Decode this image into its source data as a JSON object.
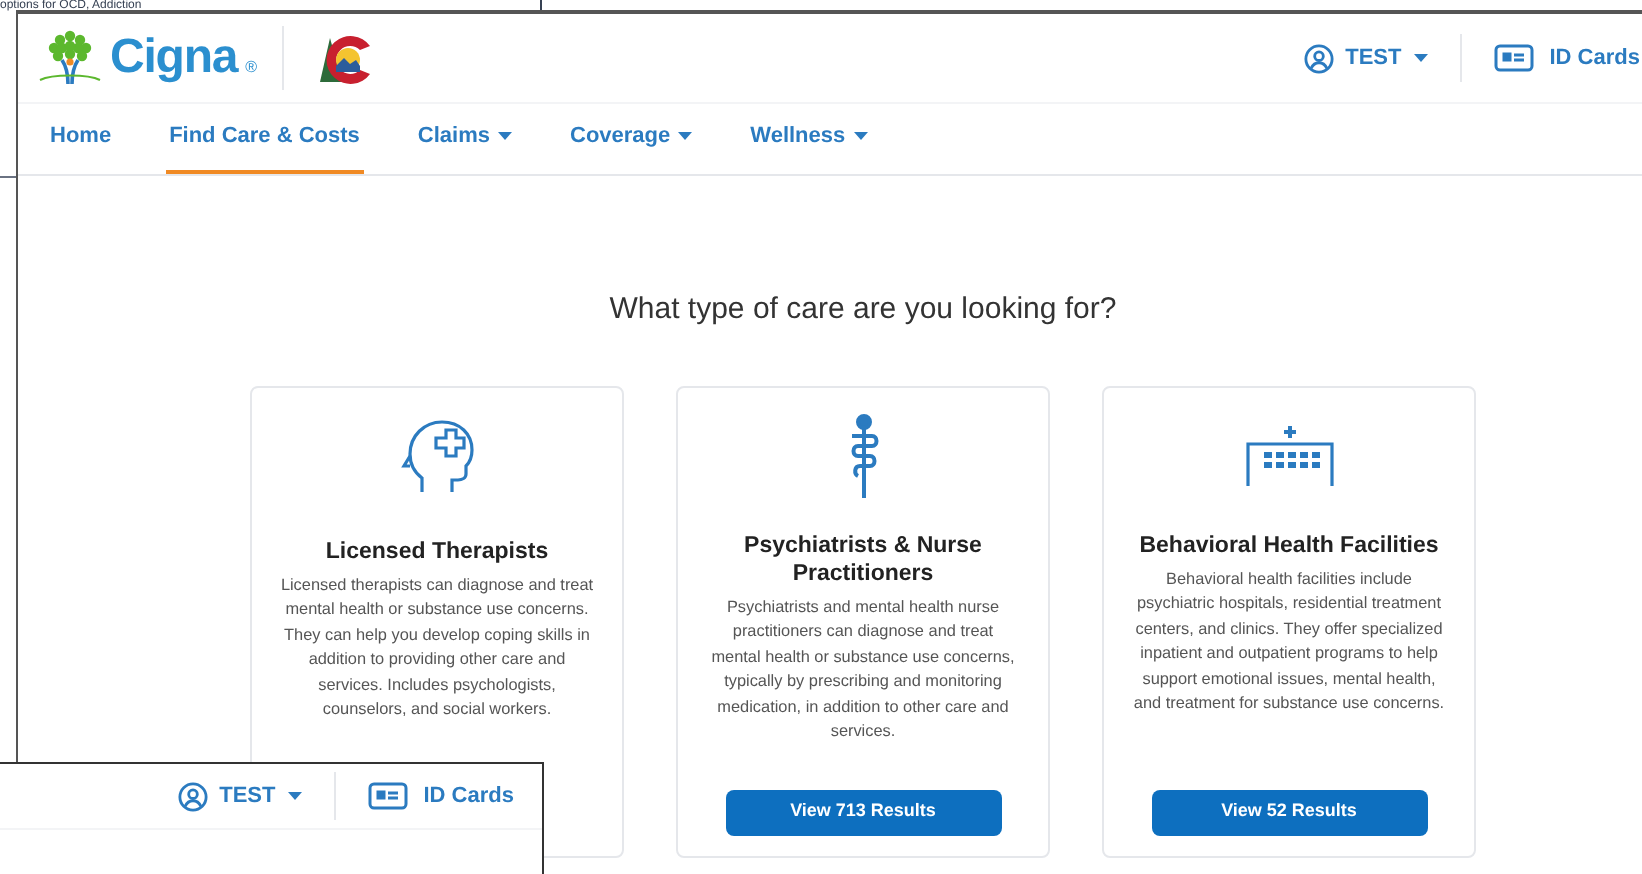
{
  "background_text": "options for OCD, Addiction",
  "header": {
    "brand": "Cigna",
    "registered": "®",
    "user_menu": "TEST",
    "id_cards": "ID Cards"
  },
  "nav": [
    {
      "label": "Home",
      "selected": false,
      "dropdown": false
    },
    {
      "label": "Find Care & Costs",
      "selected": true,
      "dropdown": false
    },
    {
      "label": "Claims",
      "selected": false,
      "dropdown": true
    },
    {
      "label": "Coverage",
      "selected": false,
      "dropdown": true
    },
    {
      "label": "Wellness",
      "selected": false,
      "dropdown": true
    }
  ],
  "heading": "What type of care are you looking for?",
  "cards": [
    {
      "kind": "head",
      "title": "Licensed Therapists",
      "description": "Licensed therapists can diagnose and treat mental health or substance use concerns. They can help you develop coping skills in addition to providing other care and services. Includes psychologists, counselors, and social workers."
    },
    {
      "kind": "staff",
      "title": "Psychiatrists & Nurse Practitioners",
      "description": "Psychiatrists and mental health nurse practitioners can diagnose and treat mental health or substance use concerns, typically by prescribing and monitoring medication, in addition to other care and services.",
      "button": "View 713 Results"
    },
    {
      "kind": "building",
      "title": "Behavioral Health Facilities",
      "description": "Behavioral health facilities include psychiatric hospitals, residential treatment centers, and clinics. They offer specialized inpatient and outpatient programs to help support emotional issues, mental health, and treatment for substance use concerns.",
      "button": "View 52 Results"
    }
  ],
  "overlay_header": {
    "user_menu": "TEST",
    "id_cards": "ID Cards"
  }
}
